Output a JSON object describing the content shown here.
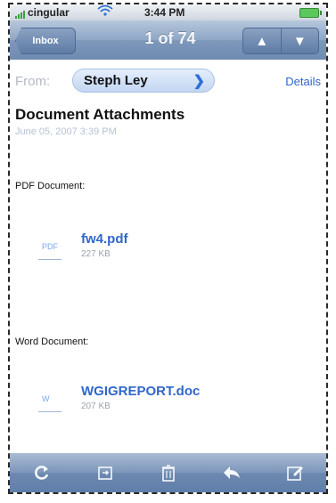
{
  "status_bar": {
    "carrier": "cingular",
    "time": "3:44 PM",
    "wifi_icon": "wifi-icon",
    "battery_icon": "battery-icon"
  },
  "nav": {
    "back_label": "Inbox",
    "title": "1 of 74",
    "up_icon": "arrow-up-icon",
    "down_icon": "arrow-down-icon"
  },
  "header": {
    "from_label": "From:",
    "sender": "Steph Ley",
    "details_label": "Details",
    "subject": "Document Attachments",
    "date": "June 05, 2007 3:39 PM"
  },
  "attachments": [
    {
      "type_label": "PDF Document:",
      "name": "fw4.pdf",
      "size": "227 KB",
      "icon_mark": "PDF",
      "icon": "pdf-file-icon"
    },
    {
      "type_label": "Word Document:",
      "name": "WGIGREPORT.doc",
      "size": "207 KB",
      "icon_mark": "W",
      "icon": "word-file-icon"
    }
  ],
  "toolbar": {
    "icons": [
      "refresh-icon",
      "move-folder-icon",
      "trash-icon",
      "reply-icon",
      "compose-icon"
    ]
  },
  "colors": {
    "nav_bar": "#7e98bb",
    "link": "#2f67c9",
    "accent_blue": "#2d6fd6"
  }
}
